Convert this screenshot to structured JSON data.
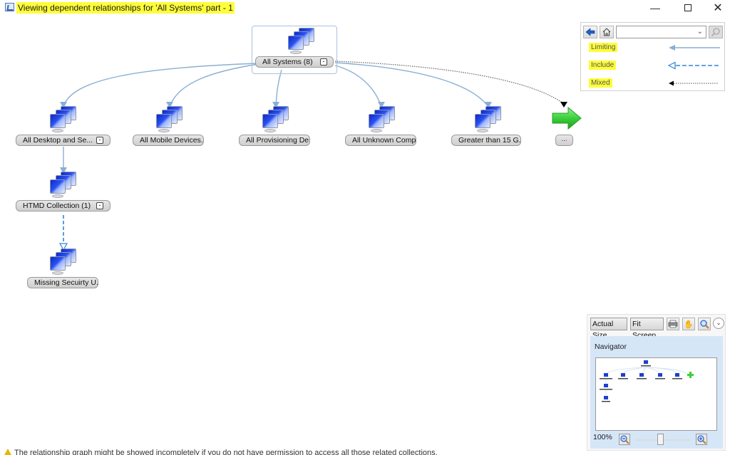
{
  "window": {
    "title": "Viewing dependent relationships for 'All Systems' part - 1",
    "minimize_icon": "minimize-icon",
    "maximize_icon": "maximize-icon",
    "close_icon": "close-icon"
  },
  "graph": {
    "root": {
      "label": "All Systems (8)",
      "collapse": "-",
      "icon": "computer-collection-icon"
    },
    "children": [
      {
        "label": "All Desktop and Se...",
        "collapse": "-",
        "icon": "computer-collection-icon",
        "relation": "Limiting"
      },
      {
        "label": "All Mobile Devices...",
        "icon": "computer-collection-icon",
        "relation": "Limiting"
      },
      {
        "label": "All Provisioning De...",
        "icon": "computer-collection-icon",
        "relation": "Limiting"
      },
      {
        "label": "All Unknown Comp...",
        "icon": "computer-collection-icon",
        "relation": "Limiting"
      },
      {
        "label": "Greater than 15 G...",
        "icon": "computer-collection-icon",
        "relation": "Limiting"
      }
    ],
    "more": {
      "label": "...",
      "icon": "green-arrow-right-icon",
      "relation": "Mixed"
    },
    "grandchild": {
      "label": "HTMD Collection (1)",
      "collapse": "-",
      "icon": "computer-collection-icon",
      "relation": "Limiting"
    },
    "great_grandchild": {
      "label": "Missing Secuirty U...",
      "icon": "computer-collection-icon",
      "relation": "Include"
    }
  },
  "legend": {
    "search_value": "",
    "back_icon": "back-arrow-icon",
    "home_icon": "home-icon",
    "search_icon": "search-icon",
    "items": [
      {
        "label": "Limiting",
        "style": "solid",
        "color": "#8aaed4"
      },
      {
        "label": "Include",
        "style": "dashed",
        "color": "#2f86d8"
      },
      {
        "label": "Mixed",
        "style": "dotted",
        "color": "#000000"
      }
    ]
  },
  "navigator": {
    "actual_size": "Actual Size",
    "fit_screen": "Fit Screen",
    "title": "Navigator",
    "zoom_level": "100%",
    "zoom_slider_fraction": 0.45
  },
  "status": {
    "message": "The relationship graph might be showed incompletely if you do not have permission to access all those related collections."
  },
  "colors": {
    "highlight": "#fdfd3a",
    "limiting_edge": "#8aaed4",
    "include_edge": "#2f86d8",
    "mixed_edge": "#555555",
    "more_arrow": "#3ccf3c",
    "navigator_bg": "#d5e6f7"
  }
}
